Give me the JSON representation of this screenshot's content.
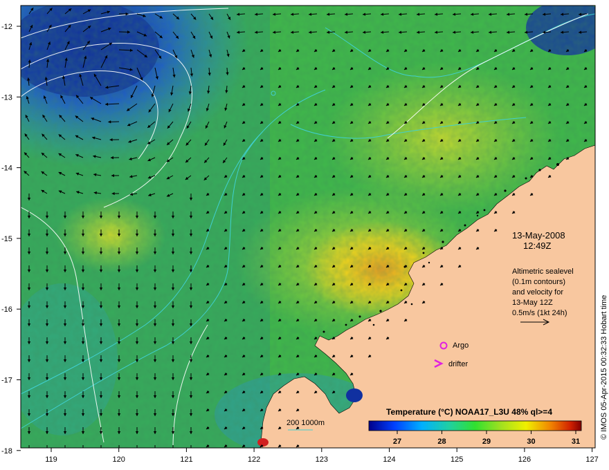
{
  "map": {
    "longitude_labels": [
      "119",
      "120",
      "121",
      "122",
      "123",
      "124",
      "125",
      "126",
      "127"
    ],
    "latitude_labels": [
      "-12",
      "-13",
      "-14",
      "-15",
      "-16",
      "-17",
      "-18"
    ],
    "date": "13-May-2008",
    "time": "12:49Z",
    "info_lines": [
      "Altimetric sealevel",
      "(0.1m contours)",
      "and velocity for",
      "13-May 12Z",
      "0.5m/s (1kt 24h)"
    ],
    "argo_label": "Argo",
    "drifter_label": "drifter",
    "bathymetry_label": "200  1000m",
    "colorbar": {
      "title": "Temperature (°C) NOAA17_L3U 48% ql>=4",
      "ticks": [
        "27",
        "28",
        "29",
        "30",
        "31"
      ]
    },
    "credit": "© IMOS 05-Apr-2015 00:32:33 Hobart time",
    "colors": {
      "land": "#f8c79f",
      "argo_marker": "#e020e0",
      "contour": "#ffffff",
      "bathymetry": "#40d0d0"
    }
  }
}
